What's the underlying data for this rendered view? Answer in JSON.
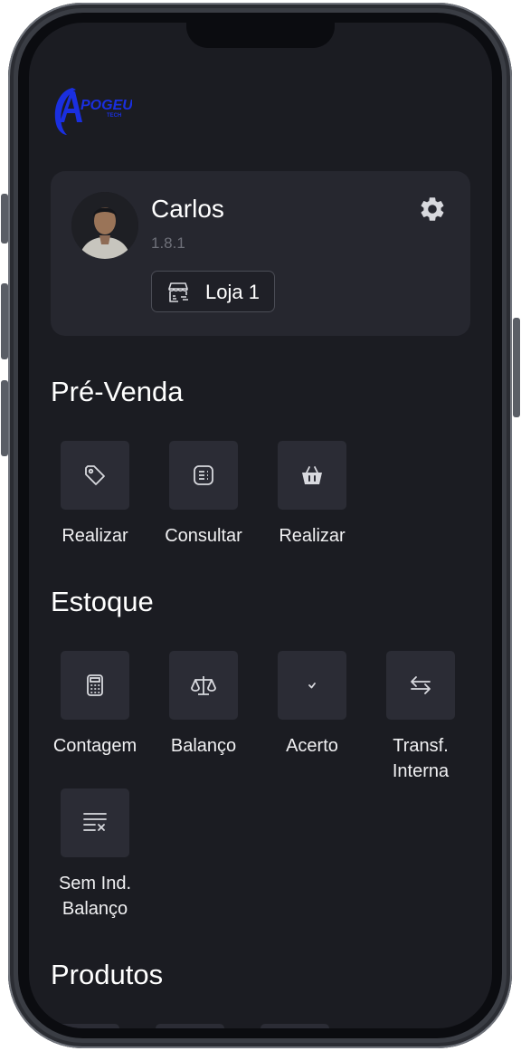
{
  "brand": {
    "logo_text": "APOGEU",
    "logo_sub": "TECH",
    "color": "#1a2fe0"
  },
  "profile": {
    "name": "Carlos",
    "version": "1.8.1",
    "store": "Loja 1"
  },
  "sections": {
    "pre_venda": {
      "title": "Pré-Venda",
      "items": [
        {
          "label": "Realizar",
          "icon": "tag-icon"
        },
        {
          "label": "Consultar",
          "icon": "receipt-list-icon"
        },
        {
          "label": "Realizar",
          "icon": "basket-icon"
        }
      ]
    },
    "estoque": {
      "title": "Estoque",
      "items": [
        {
          "label": "Contagem",
          "icon": "calculator-icon"
        },
        {
          "label": "Balanço",
          "icon": "scale-icon"
        },
        {
          "label": "Acerto",
          "icon": "checkbox-icon"
        },
        {
          "label": "Transf. Interna",
          "icon": "transfer-arrows-icon"
        },
        {
          "label": "Sem Ind. Balanço",
          "icon": "list-remove-icon"
        }
      ]
    },
    "produtos": {
      "title": "Produtos"
    }
  },
  "colors": {
    "background": "#1b1c22",
    "card": "#26272f",
    "tile": "#2b2c35",
    "muted_text": "#6e7079",
    "icon": "#d8d9de"
  }
}
